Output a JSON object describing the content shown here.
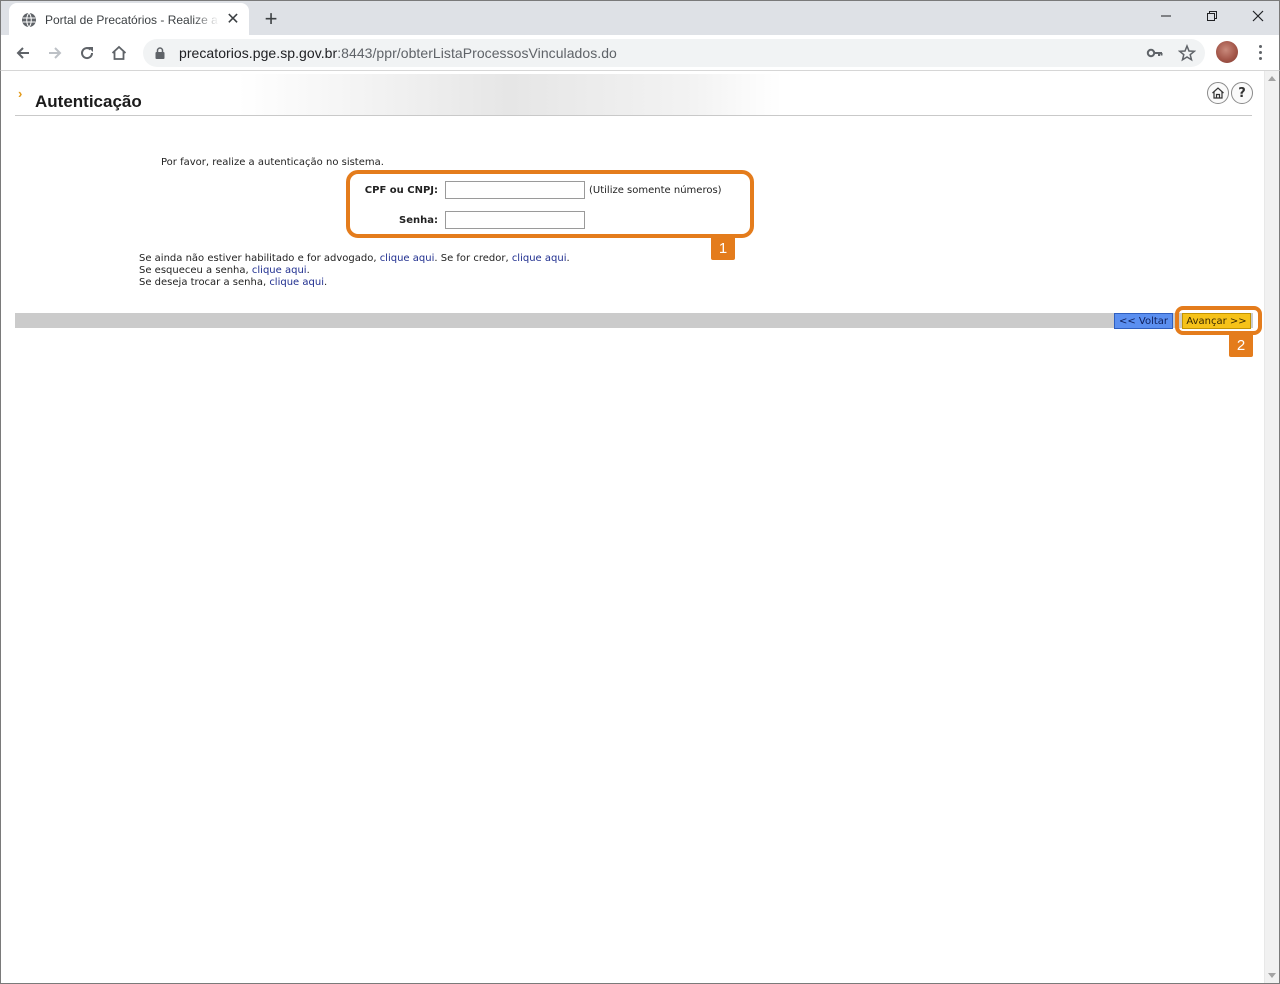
{
  "browser": {
    "tab_title": "Portal de Precatórios - Realize a autenticação",
    "new_tab_symbol": "+",
    "tab_close_symbol": "✕",
    "url_host": "precatorios.pge.sp.gov.br",
    "url_path": ":8443/ppr/obterListaProcessosVinculados.do"
  },
  "page": {
    "title": "Autenticação",
    "intro": "Por favor, realize a autenticação no sistema.",
    "help_symbol": "?",
    "form": {
      "cpf_label": "CPF ou CNPJ:",
      "cpf_value": "",
      "cpf_hint": "(Utilize somente números)",
      "senha_label": "Senha:",
      "senha_value": ""
    },
    "links": {
      "line1_text_a": "Se ainda não estiver habilitado e for advogado, ",
      "line1_link_a": "clique aqui",
      "line1_text_b": ". Se for credor, ",
      "line1_link_b": "clique aqui",
      "line1_text_c": ".",
      "line2_text": "Se esqueceu a senha, ",
      "line2_link": "clique aqui",
      "line2_end": ".",
      "line3_text": "Se deseja trocar a senha, ",
      "line3_link": "clique aqui",
      "line3_end": "."
    },
    "buttons": {
      "voltar": "<< Voltar",
      "avancar": "Avançar >>"
    }
  },
  "annotations": {
    "badge1": "1",
    "badge2": "2",
    "color": "#e47c1c"
  },
  "colors": {
    "voltar_bg": "#5b8ff0",
    "avancar_bg": "#f6c219",
    "link": "#1f2e8f"
  }
}
